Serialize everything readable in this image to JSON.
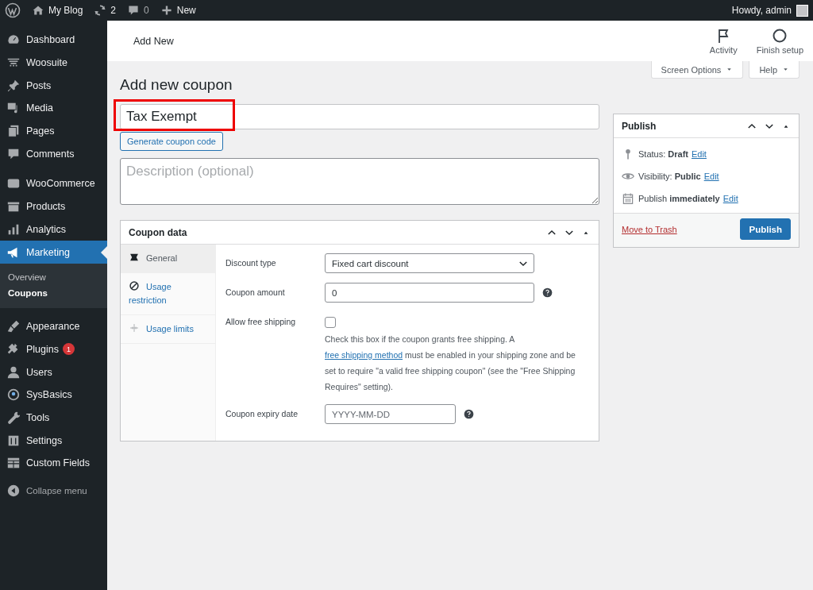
{
  "admin_bar": {
    "site": "My Blog",
    "updates": "2",
    "comments": "0",
    "new": "New",
    "greeting": "Howdy, admin"
  },
  "sidebar": {
    "groups": [
      {
        "items": [
          {
            "label": "Dashboard",
            "selected": false
          },
          {
            "label": "Woosuite",
            "selected": false
          },
          {
            "label": "Posts",
            "selected": false
          },
          {
            "label": "Media",
            "selected": false
          },
          {
            "label": "Pages",
            "selected": false
          },
          {
            "label": "Comments",
            "selected": false
          }
        ]
      },
      {
        "items": [
          {
            "label": "WooCommerce",
            "selected": false
          },
          {
            "label": "Products",
            "selected": false
          },
          {
            "label": "Analytics",
            "selected": false
          },
          {
            "label": "Marketing",
            "selected": true,
            "children": [
              {
                "label": "Overview",
                "selected": false
              },
              {
                "label": "Coupons",
                "selected": true
              }
            ]
          }
        ]
      },
      {
        "items": [
          {
            "label": "Appearance",
            "selected": false
          },
          {
            "label": "Plugins",
            "selected": false,
            "badge": "1"
          },
          {
            "label": "Users",
            "selected": false
          },
          {
            "label": "SysBasics",
            "selected": false
          },
          {
            "label": "Tools",
            "selected": false
          },
          {
            "label": "Settings",
            "selected": false
          },
          {
            "label": "Custom Fields",
            "selected": false
          }
        ]
      }
    ],
    "collapse": "Collapse menu"
  },
  "header": {
    "title": "Add New",
    "actions": [
      "Activity",
      "Finish setup"
    ]
  },
  "screen_tabs": [
    "Screen Options",
    "Help"
  ],
  "page_title": "Add new coupon",
  "title_field": {
    "value": "Tax Exempt",
    "highlighted": true
  },
  "generate_button": "Generate coupon code",
  "description_field": {
    "placeholder": "Description (optional)"
  },
  "coupon_data": {
    "title": "Coupon data",
    "tabs": [
      {
        "label": "General",
        "selected": true
      },
      {
        "label": "Usage restriction",
        "selected": false
      },
      {
        "label": "Usage limits",
        "selected": false
      }
    ],
    "fields": [
      {
        "kind": "select",
        "label": "Discount type",
        "value": "Fixed cart discount"
      },
      {
        "kind": "text",
        "label": "Coupon amount",
        "value": "0",
        "help": true
      },
      {
        "kind": "checkbox",
        "label": "Allow free shipping",
        "checked": false,
        "description": {
          "before": "Check this box if the coupon grants free shipping. A ",
          "link": "free shipping method",
          "after": " must be enabled in your shipping zone and be set to require \"a valid free shipping coupon\" (see the \"Free Shipping Requires\" setting)."
        }
      },
      {
        "kind": "date",
        "label": "Coupon expiry date",
        "placeholder": "YYYY-MM-DD",
        "help": true
      }
    ]
  },
  "publish": {
    "title": "Publish",
    "rows": [
      {
        "kind": "status",
        "text": "Status: **Draft**",
        "link": "Edit"
      },
      {
        "kind": "visibility",
        "text": "Visibility: **Public**",
        "link": "Edit"
      },
      {
        "kind": "schedule",
        "text": "Publish **immediately**",
        "link": "Edit"
      }
    ],
    "trash": "Move to Trash",
    "button": "Publish"
  }
}
